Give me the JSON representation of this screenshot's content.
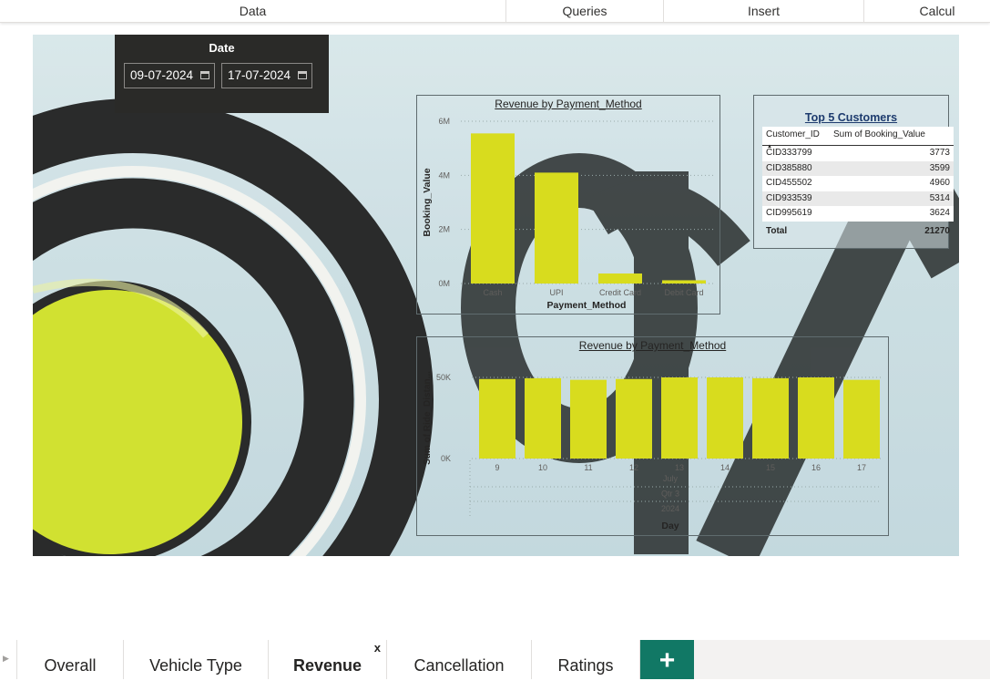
{
  "ribbon": {
    "items": [
      {
        "label": "Data"
      },
      {
        "label": "Queries"
      },
      {
        "label": "Insert"
      },
      {
        "label": "Calcul"
      }
    ]
  },
  "slicer": {
    "title": "Date",
    "start_date": "09-07-2024",
    "end_date": "17-07-2024"
  },
  "payment_chart": {
    "title": "Revenue by Payment_Method",
    "chart_data": {
      "type": "bar",
      "title": "Revenue by Payment_Method",
      "xlabel": "Payment_Method",
      "ylabel": "Booking_Value",
      "categories": [
        "Cash",
        "UPI",
        "Credit Card",
        "Debit Card"
      ],
      "values": [
        5550000,
        4100000,
        370000,
        120000
      ],
      "yticks": [
        "0M",
        "2M",
        "4M",
        "6M"
      ],
      "ylim": [
        0,
        6000000
      ],
      "color": "#d8dc1e"
    }
  },
  "customers_table": {
    "title": "Top 5 Customers",
    "col_customer": "Customer_ID",
    "col_value": "Sum of Booking_Value",
    "rows": [
      {
        "id": "CID333799",
        "value": "3773"
      },
      {
        "id": "CID385880",
        "value": "3599"
      },
      {
        "id": "CID455502",
        "value": "4960"
      },
      {
        "id": "CID933539",
        "value": "5314"
      },
      {
        "id": "CID995619",
        "value": "3624"
      }
    ],
    "total_label": "Total",
    "total_value": "21270"
  },
  "day_chart": {
    "title": "Revenue by Payment_Method",
    "chart_data": {
      "type": "bar",
      "title": "Revenue by Payment_Method",
      "xlabel": "Day",
      "ylabel": "Sum of Ride_Distan...",
      "categories": [
        "9",
        "10",
        "11",
        "12",
        "13",
        "14",
        "15",
        "16",
        "17"
      ],
      "values": [
        49000,
        49500,
        48500,
        49000,
        50000,
        50000,
        49500,
        50000,
        48500
      ],
      "yticks": [
        "0K",
        "50K"
      ],
      "ylim": [
        0,
        50000
      ],
      "hierarchy": [
        "July",
        "Qtr 3",
        "2024"
      ],
      "color": "#d8dc1e"
    }
  },
  "tabs": [
    {
      "label": "Overall"
    },
    {
      "label": "Vehicle Type"
    },
    {
      "label": "Revenue",
      "close": "x"
    },
    {
      "label": "Cancellation"
    },
    {
      "label": "Ratings"
    }
  ],
  "add_tab_label": "+",
  "colors": {
    "accent": "#117865",
    "bar": "#d8dc1e",
    "slicer_bg": "#2a2a28"
  }
}
